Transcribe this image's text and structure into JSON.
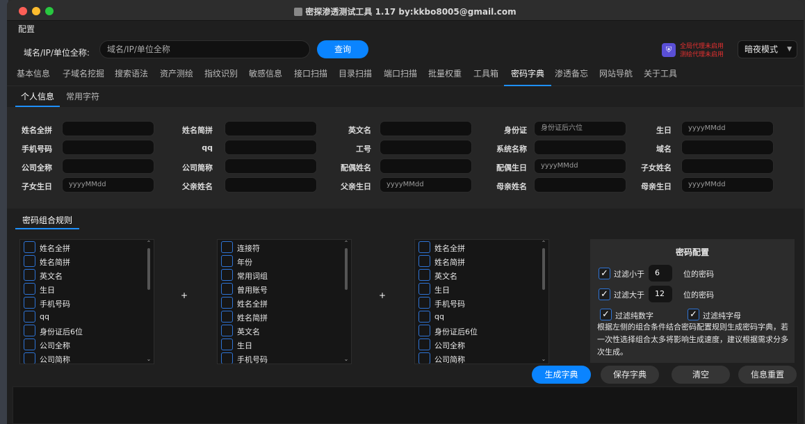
{
  "window": {
    "title": "密探渗透测试工具 1.17 by:kkbo8005@gmail.com"
  },
  "menubar": {
    "label": "配置"
  },
  "query": {
    "label": "域名/IP/单位全称:",
    "placeholder": "域名/IP/单位全称",
    "button": "查询",
    "proxy_line1": "全局代理未启用",
    "proxy_line2": "测绘代理未启用",
    "mode": "暗夜模式"
  },
  "tabs": [
    "基本信息",
    "子域名挖掘",
    "搜索语法",
    "资产测绘",
    "指纹识别",
    "敏感信息",
    "接口扫描",
    "目录扫描",
    "端口扫描",
    "批量权重",
    "工具箱",
    "密码字典",
    "渗透备忘",
    "网站导航",
    "关于工具"
  ],
  "subtabs": [
    "个人信息",
    "常用字符"
  ],
  "fields": [
    {
      "label": "姓名全拼",
      "value": ""
    },
    {
      "label": "姓名简拼",
      "value": ""
    },
    {
      "label": "英文名",
      "value": ""
    },
    {
      "label": "身份证",
      "value": "身份证后六位"
    },
    {
      "label": "生日",
      "value": "yyyyMMdd"
    },
    {
      "label": "手机号码",
      "value": ""
    },
    {
      "label": "qq",
      "value": ""
    },
    {
      "label": "工号",
      "value": ""
    },
    {
      "label": "系统名称",
      "value": ""
    },
    {
      "label": "域名",
      "value": ""
    },
    {
      "label": "公司全称",
      "value": ""
    },
    {
      "label": "公司简称",
      "value": ""
    },
    {
      "label": "配偶姓名",
      "value": ""
    },
    {
      "label": "配偶生日",
      "value": "yyyyMMdd"
    },
    {
      "label": "子女姓名",
      "value": ""
    },
    {
      "label": "子女生日",
      "value": "yyyyMMdd"
    },
    {
      "label": "父亲姓名",
      "value": ""
    },
    {
      "label": "父亲生日",
      "value": "yyyyMMdd"
    },
    {
      "label": "母亲姓名",
      "value": ""
    },
    {
      "label": "母亲生日",
      "value": "yyyyMMdd"
    }
  ],
  "rules_tab": "密码组合规则",
  "lists": [
    [
      "姓名全拼",
      "姓名简拼",
      "英文名",
      "生日",
      "手机号码",
      "qq",
      "身份证后6位",
      "公司全称",
      "公司简称"
    ],
    [
      "连接符",
      "年份",
      "常用词组",
      "曾用账号",
      "姓名全拼",
      "姓名简拼",
      "英文名",
      "生日",
      "手机号码"
    ],
    [
      "姓名全拼",
      "姓名简拼",
      "英文名",
      "生日",
      "手机号码",
      "qq",
      "身份证后6位",
      "公司全称",
      "公司简称"
    ]
  ],
  "plus": "+",
  "config": {
    "title": "密码配置",
    "filter_less": "过滤小于",
    "less_value": "6",
    "filter_more": "过滤大于",
    "more_value": "12",
    "unit": "位的密码",
    "pure_digits": "过滤纯数字",
    "pure_letters": "过滤纯字母",
    "check": "✓",
    "desc": "根据左侧的组合条件结合密码配置规则生成密码字典，若一次性选择组合太多将影响生成速度，建议根据需求分多次生成。"
  },
  "buttons": {
    "generate": "生成字典",
    "save": "保存字典",
    "clear": "清空",
    "reset": "信息重置"
  },
  "colors": {
    "accent": "#0a84ff",
    "proxy_warning": "#e53030"
  }
}
